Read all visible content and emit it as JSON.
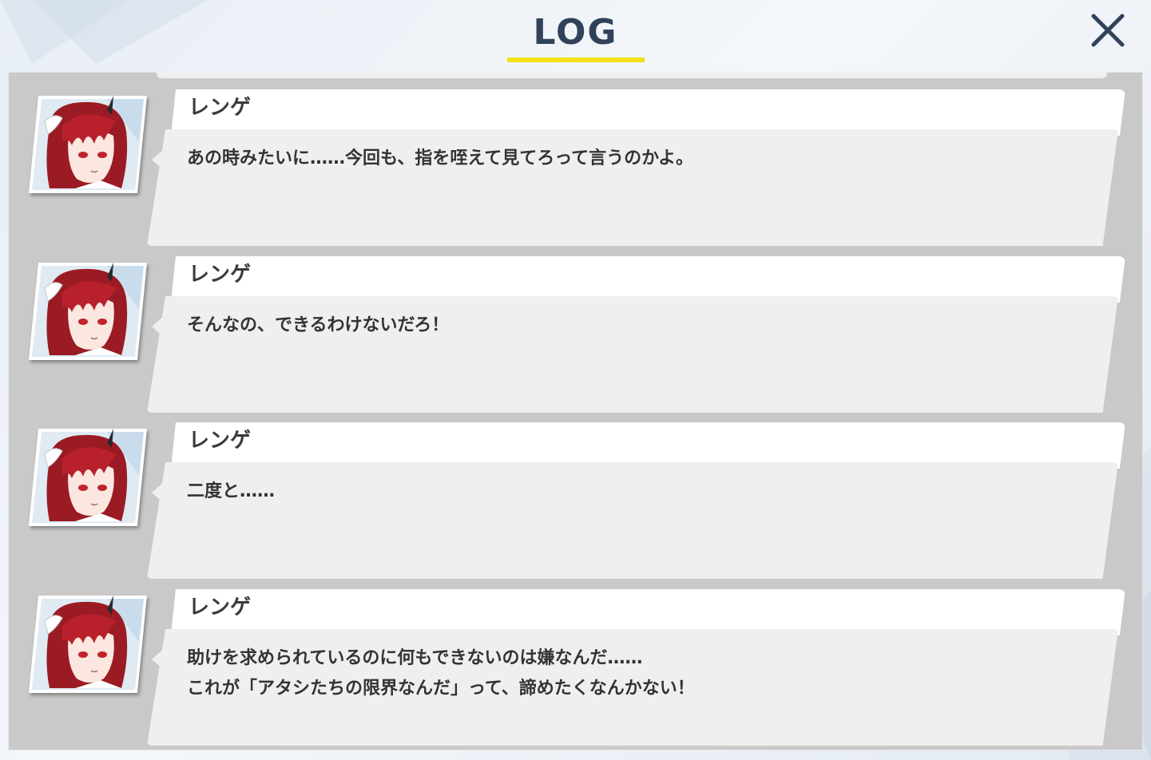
{
  "header": {
    "title": "LOG",
    "close_icon": "close-icon",
    "accent_color": "#f5e118",
    "title_color": "#2f4259"
  },
  "log": {
    "entries": [
      {
        "speaker": "レンゲ",
        "avatar": "renge-avatar",
        "lines": [
          "あの時みたいに……今回も、指を咥えて見てろって言うのかよ。"
        ]
      },
      {
        "speaker": "レンゲ",
        "avatar": "renge-avatar",
        "lines": [
          "そんなの、できるわけないだろ！"
        ]
      },
      {
        "speaker": "レンゲ",
        "avatar": "renge-avatar",
        "lines": [
          "二度と……"
        ]
      },
      {
        "speaker": "レンゲ",
        "avatar": "renge-avatar",
        "lines": [
          "助けを求められているのに何もできないのは嫌なんだ……",
          "これが「アタシたちの限界なんだ」って、諦めたくなんかない！"
        ]
      }
    ]
  }
}
